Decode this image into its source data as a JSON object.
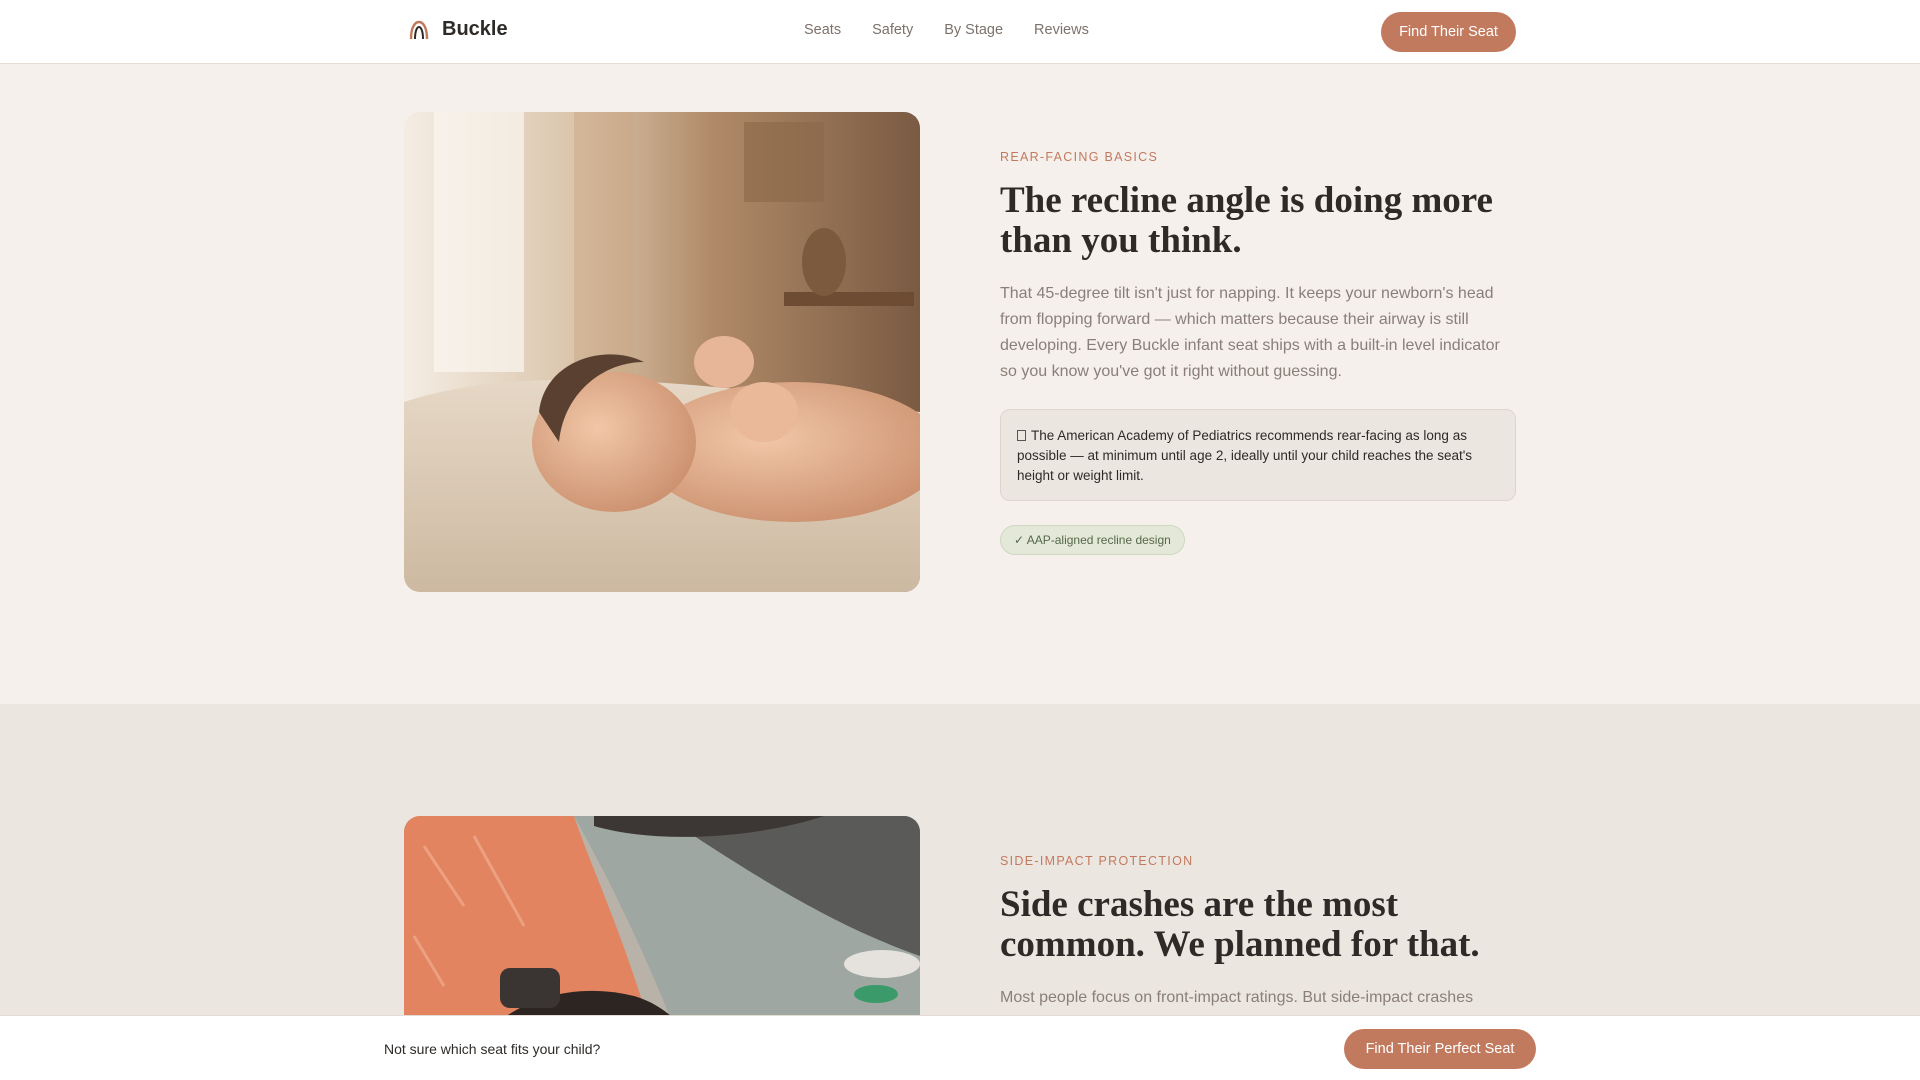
{
  "nav": {
    "brand": "Buckle",
    "links": [
      "Seats",
      "Safety",
      "By Stage",
      "Reviews"
    ],
    "cta": "Find Their Seat"
  },
  "section1": {
    "eyebrow": "REAR-FACING BASICS",
    "headline": "The recline angle is doing more than you think.",
    "body": "That 45-degree tilt isn't just for napping. It keeps your newborn's head from flopping forward — which matters because their airway is still developing. Every Buckle infant seat ships with a built-in level indicator so you know you've got it right without guessing.",
    "callout": "The American Academy of Pediatrics recommends rear-facing as long as possible — at minimum until age 2, ideally until your child reaches the seat's height or weight limit.",
    "badge": "✓ AAP-aligned recline design"
  },
  "section2": {
    "eyebrow": "SIDE-IMPACT PROTECTION",
    "headline": "Side crashes are the most common. We planned for that.",
    "body": "Most people focus on front-impact ratings. But side-impact crashes"
  },
  "bottom_bar": {
    "prompt": "Not sure which seat fits your child?",
    "cta": "Find Their Perfect Seat"
  },
  "colors": {
    "accent": "#c27a5f",
    "background": "#f5f0ec",
    "section_alt": "#ece6e0"
  }
}
